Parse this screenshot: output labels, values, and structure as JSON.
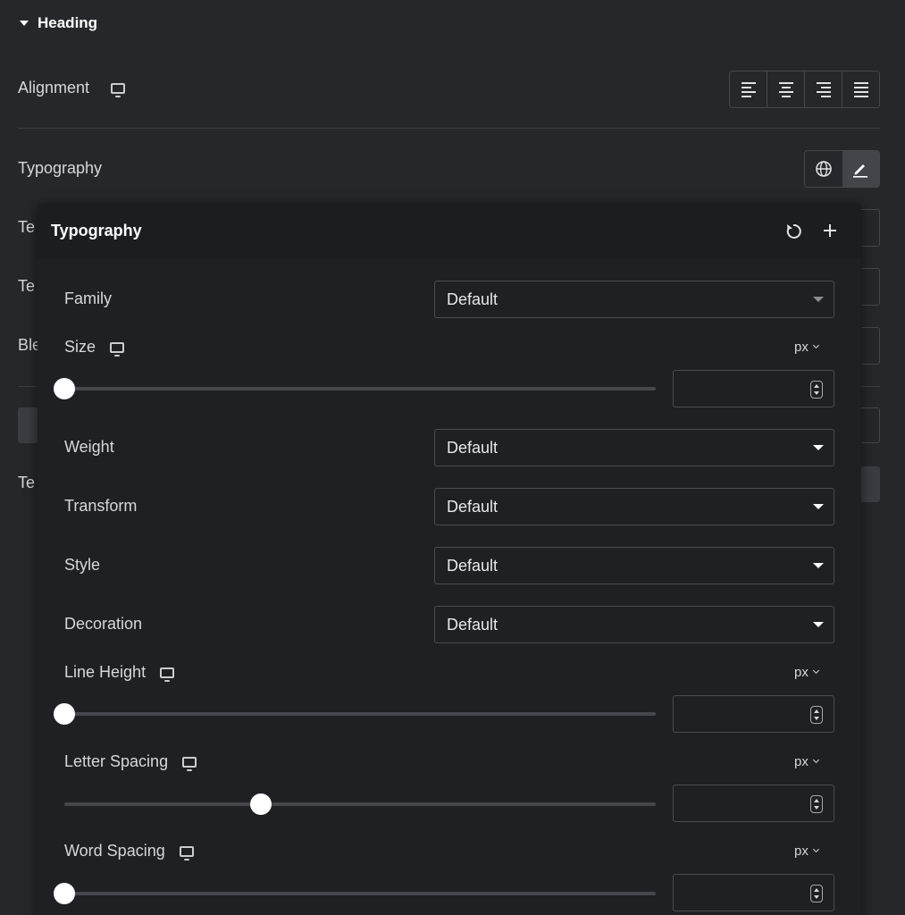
{
  "section": {
    "title": "Heading"
  },
  "alignment": {
    "label": "Alignment",
    "responsive_icon": "monitor-icon",
    "options": [
      "align-left-icon",
      "align-center-icon",
      "align-right-icon",
      "align-justify-icon"
    ]
  },
  "typography_row": {
    "label": "Typography",
    "global_icon": "globe-icon",
    "edit_icon": "pencil-icon"
  },
  "hidden_rows": [
    {
      "label_peek": "Te"
    },
    {
      "label_peek": "Te"
    },
    {
      "label_peek": "Ble"
    },
    {
      "label_peek": "Te"
    }
  ],
  "popover": {
    "title": "Typography",
    "reset_icon": "reset-icon",
    "add_icon": "plus-icon",
    "family": {
      "label": "Family",
      "value": "Default"
    },
    "size": {
      "label": "Size",
      "unit": "px",
      "value": "",
      "slider_fraction": 0.0
    },
    "weight": {
      "label": "Weight",
      "value": "Default"
    },
    "transform": {
      "label": "Transform",
      "value": "Default"
    },
    "style": {
      "label": "Style",
      "value": "Default"
    },
    "decoration": {
      "label": "Decoration",
      "value": "Default"
    },
    "line_height": {
      "label": "Line Height",
      "unit": "px",
      "value": "",
      "slider_fraction": 0.0
    },
    "letter_spacing": {
      "label": "Letter Spacing",
      "unit": "px",
      "value": "",
      "slider_fraction": 0.333
    },
    "word_spacing": {
      "label": "Word Spacing",
      "unit": "px",
      "value": "",
      "slider_fraction": 0.0
    }
  },
  "colors": {
    "panel_bg": "#26272b",
    "popover_bg": "#1f2024",
    "accent_thumb": "#ffffff"
  }
}
